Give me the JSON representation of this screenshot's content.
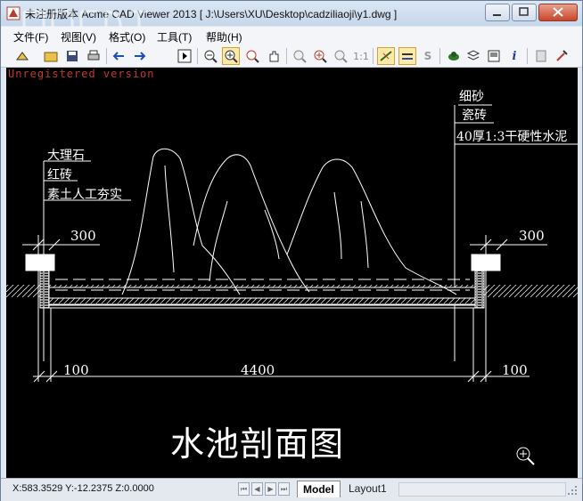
{
  "window": {
    "title": "未注册版本 Acme CAD Viewer 2013 [ J:\\Users\\XU\\Desktop\\cadziliaoji\\y1.dwg ]"
  },
  "menu": {
    "items": [
      "文件(F)",
      "视图(V)",
      "格式(O)",
      "工具(T)",
      "帮助(H)"
    ]
  },
  "toolbar": {
    "icons": [
      "open-icon",
      "save-icon",
      "print-icon",
      "back-icon",
      "forward-icon",
      "play-icon",
      "zoom-out-icon",
      "zoom-window-icon",
      "zoom-in-icon",
      "pan-icon",
      "zoom-extents-icon",
      "zoom-realtime-icon",
      "zoom-previous-icon",
      "zoom-1to1-icon",
      "linewidth-icon",
      "bw-icon",
      "layer-icon",
      "layer-state-icon",
      "layout-icon",
      "info-icon",
      "properties-icon",
      "settings-icon"
    ],
    "one_to_one_label": "1:1",
    "s_label": "S",
    "info_label": "i"
  },
  "canvas": {
    "unregistered": "Unregistered version",
    "drawing_title": "水池剖面图",
    "labels_left": [
      "大理石",
      "红砖",
      "素土人工夯实"
    ],
    "labels_right": [
      "细砂",
      "瓷砖",
      "40厚1:3干硬性水泥"
    ],
    "dim_top_left": "300",
    "dim_top_right": "300",
    "dim_bottom_left": "100",
    "dim_bottom_middle": "4400",
    "dim_bottom_right": "100",
    "background": "#000000",
    "line_color": "#ffffff"
  },
  "status": {
    "coords": "X:583.3529 Y:-12.2375 Z:0.0000",
    "tabs": [
      "Model",
      "Layout1"
    ],
    "active_tab": "Model"
  }
}
